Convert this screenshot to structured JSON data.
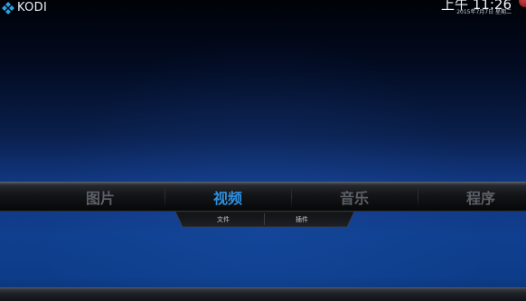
{
  "app": {
    "logo_text": "KODI",
    "logo_icon": "kodi-logo-icon"
  },
  "status": {
    "time": "上午 11:26",
    "date": "2015年7月7日 星期二"
  },
  "main_menu": {
    "items": [
      {
        "label": "图片",
        "active": false
      },
      {
        "label": "视频",
        "active": true
      },
      {
        "label": "音乐",
        "active": false
      },
      {
        "label": "程序",
        "active": false
      }
    ]
  },
  "submenu": {
    "items": [
      {
        "label": "文件"
      },
      {
        "label": "插件"
      }
    ]
  },
  "colors": {
    "accent": "#2f90e0",
    "inactive": "#5c6068",
    "background_top": "#000207",
    "background_bottom": "#123a86"
  }
}
